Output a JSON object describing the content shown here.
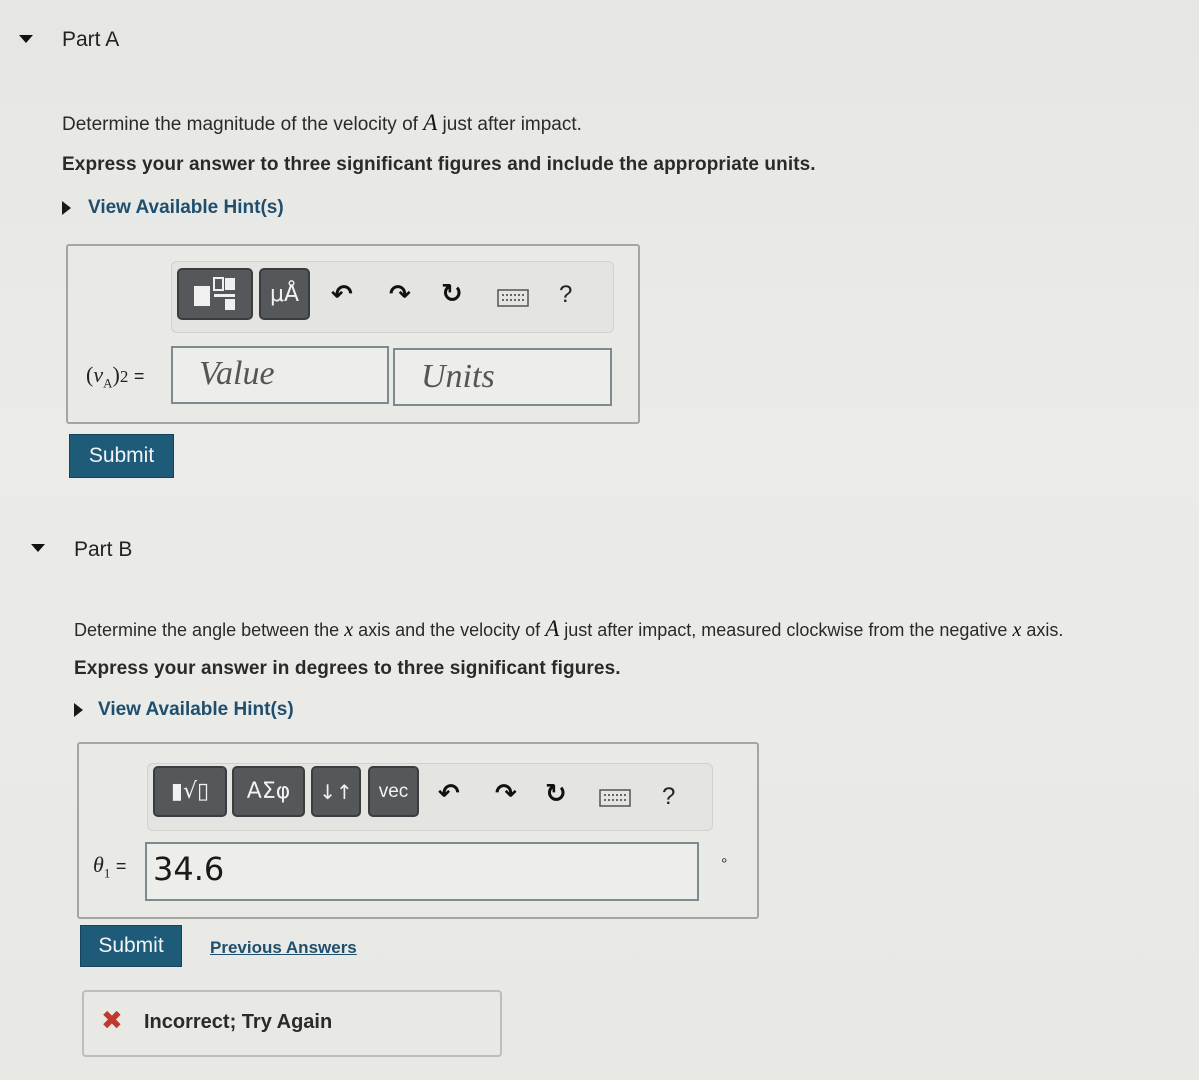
{
  "part_a": {
    "title": "Part A",
    "prompt_before": "Determine the magnitude of the velocity of ",
    "prompt_var": "A",
    "prompt_after": " just after impact.",
    "instruction": "Express your answer to three significant figures and include the appropriate units.",
    "hint_label": "View Available Hint(s)",
    "toolbar": {
      "templates_icon": "templates-icon",
      "units_label": "μÅ",
      "undo_icon": "undo-icon",
      "redo_icon": "redo-icon",
      "reset_icon": "reset-icon",
      "keyboard_icon": "keyboard-icon",
      "help_label": "?"
    },
    "answer_label": "(vA)2 =",
    "value_placeholder": "Value",
    "units_placeholder": "Units",
    "submit_label": "Submit"
  },
  "part_b": {
    "title": "Part B",
    "prompt_1": "Determine the angle between the ",
    "prompt_x1": "x",
    "prompt_2": " axis and the velocity of ",
    "prompt_var": "A",
    "prompt_3": " just after impact, measured clockwise from the negative ",
    "prompt_x2": "x",
    "prompt_4": " axis.",
    "instruction": "Express your answer in degrees to three significant figures.",
    "hint_label": "View Available Hint(s)",
    "toolbar": {
      "templates_label": "▮√▯",
      "greek_label": "ΑΣφ",
      "arrows_label": "↓↑",
      "vec_label": "vec",
      "help_label": "?"
    },
    "answer_label": "θ1 =",
    "answer_value": "34.6",
    "unit_symbol": "°",
    "submit_label": "Submit",
    "previous_answers_label": "Previous Answers",
    "feedback_text": "Incorrect; Try Again"
  },
  "colors": {
    "submit_bg": "#1d5b79",
    "link": "#1f4f6e",
    "error": "#c0392b",
    "toolbar_button": "#54585a"
  }
}
